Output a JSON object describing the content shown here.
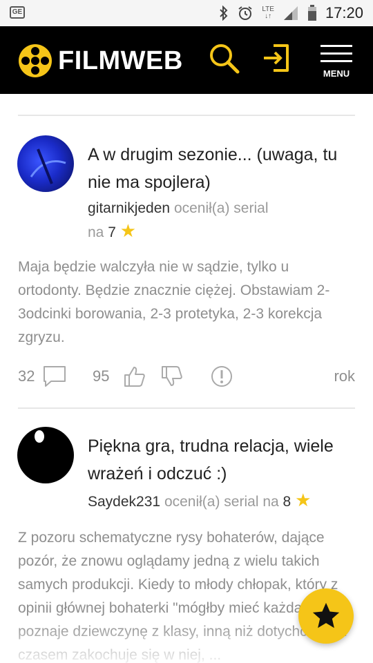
{
  "status_bar": {
    "left_icon": "GE",
    "network": "LTE",
    "time": "17:20"
  },
  "header": {
    "logo_text": "FILMWEB",
    "menu_label": "MENU",
    "accent_color": "#f5c518"
  },
  "reviews": [
    {
      "title": "A w drugim sezonie... (uwaga, tu nie ma spojlera)",
      "user": "gitarnikjeden",
      "rated_text": "ocenił(a) serial",
      "na": "na",
      "grade": "7",
      "body": "Maja będzie walczyła nie w sądzie, tylko u ortodonty. Będzie znacznie ciężej. Obstawiam 2-3odcinki borowania, 2-3 protetyka, 2-3 korekcja zgryzu.",
      "comments": "32",
      "likes": "95",
      "age": "rok"
    },
    {
      "title": "Piękna gra, trudna relacja, wiele wrażeń i odczuć :)",
      "user": "Saydek231",
      "rated_text": "ocenił(a) serial",
      "na": "na",
      "grade": "8",
      "body": "Z pozoru schematyczne rysy bohaterów, dające pozór, że znowu oglądamy jedną z wielu takich samych produkcji. Kiedy to młody chłopak, który z opinii głównej bohaterki \"mógłby mieć każdą\", poznaje dziewczynę z klasy, inną niż dotychczas. Z czasem zakochuje się w niej, ..."
    }
  ]
}
